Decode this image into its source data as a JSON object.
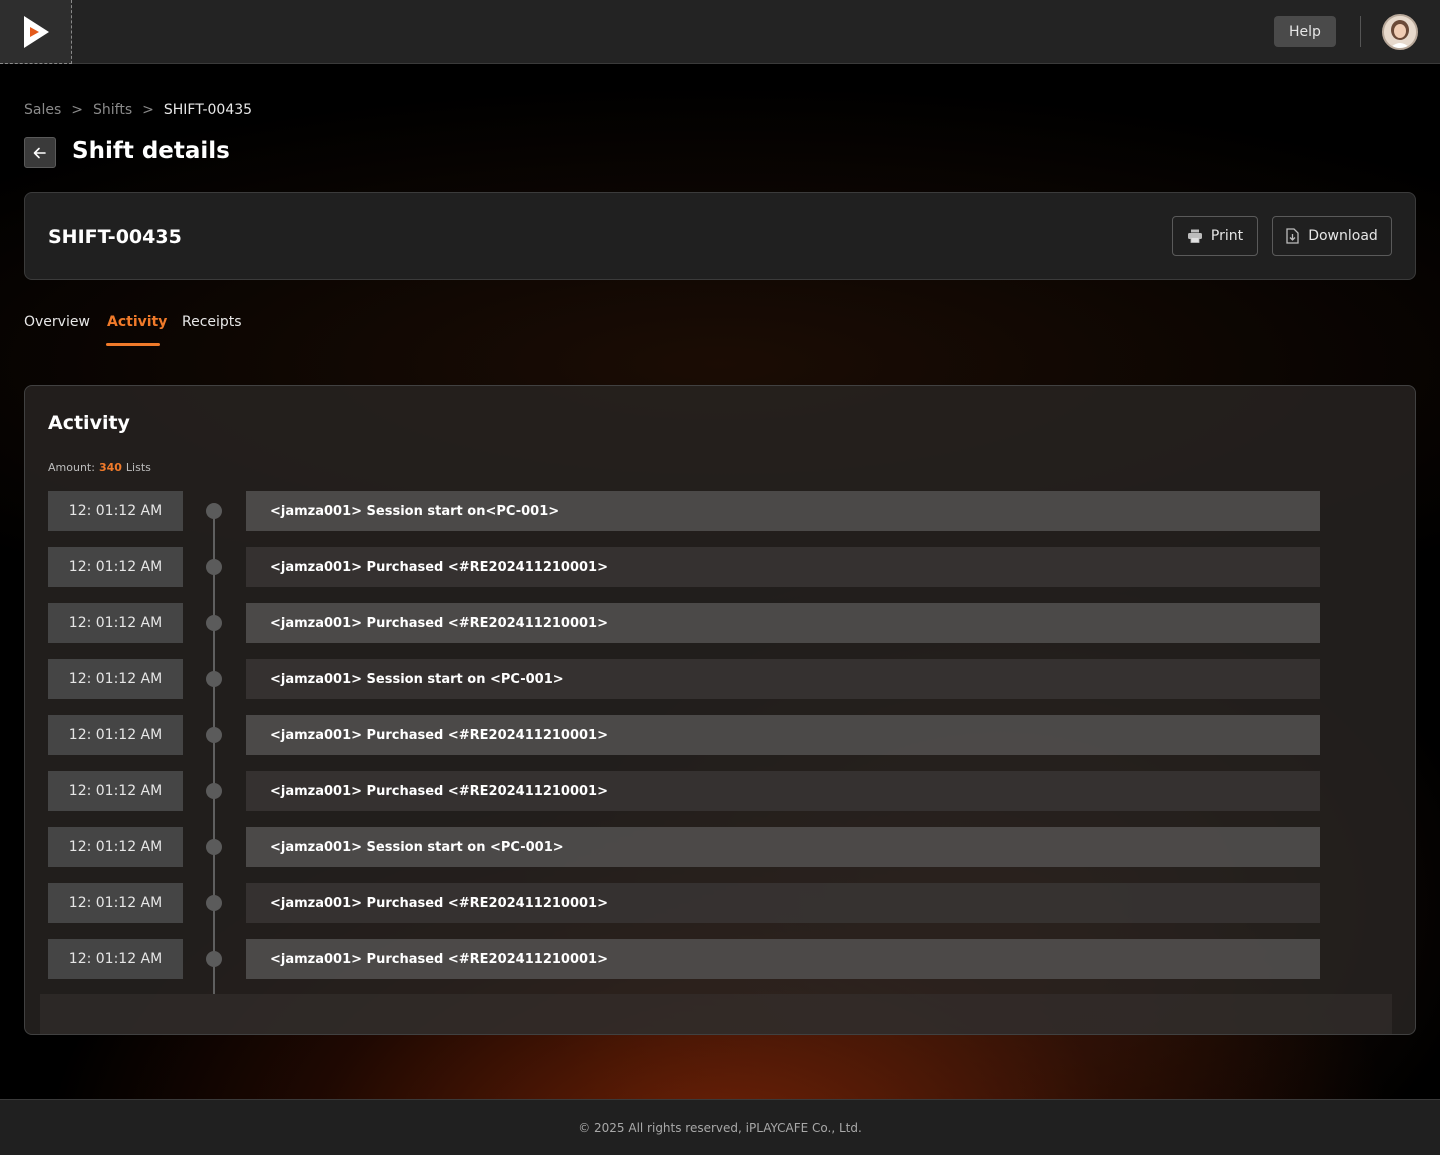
{
  "header": {
    "help_label": "Help"
  },
  "breadcrumb": {
    "items": [
      "Sales",
      "Shifts",
      "SHIFT-00435"
    ],
    "separator": ">"
  },
  "page": {
    "title": "Shift details"
  },
  "shift_card": {
    "id": "SHIFT-00435",
    "print_label": "Print",
    "download_label": "Download"
  },
  "tabs": [
    {
      "label": "Overview",
      "active": false
    },
    {
      "label": "Activity",
      "active": true
    },
    {
      "label": "Receipts",
      "active": false
    }
  ],
  "activity": {
    "title": "Activity",
    "amount_label": "Amount:",
    "amount_value": "340",
    "amount_unit": "Lists",
    "rows": [
      {
        "time": "12: 01:12 AM",
        "event": "<jamza001> Session start on<PC-001>"
      },
      {
        "time": "12: 01:12 AM",
        "event": "<jamza001> Purchased <#RE202411210001>"
      },
      {
        "time": "12: 01:12 AM",
        "event": "<jamza001> Purchased <#RE202411210001>"
      },
      {
        "time": "12: 01:12 AM",
        "event": "<jamza001> Session start on <PC-001>"
      },
      {
        "time": "12: 01:12 AM",
        "event": "<jamza001> Purchased <#RE202411210001>"
      },
      {
        "time": "12: 01:12 AM",
        "event": "<jamza001> Purchased <#RE202411210001>"
      },
      {
        "time": "12: 01:12 AM",
        "event": "<jamza001> Session start on <PC-001>"
      },
      {
        "time": "12: 01:12 AM",
        "event": "<jamza001> Purchased <#RE202411210001>"
      },
      {
        "time": "12: 01:12 AM",
        "event": "<jamza001> Purchased <#RE202411210001>"
      }
    ]
  },
  "footer": {
    "copyright": "© 2025 All rights reserved, iPLAYCAFE Co., Ltd."
  },
  "icons": {
    "logo": "play-logo-icon",
    "back": "arrow-left-icon",
    "print": "printer-icon",
    "download": "download-file-icon",
    "avatar": "user-avatar"
  },
  "colors": {
    "accent": "#f07a2a",
    "topbar": "#232323",
    "card": "#202020"
  }
}
